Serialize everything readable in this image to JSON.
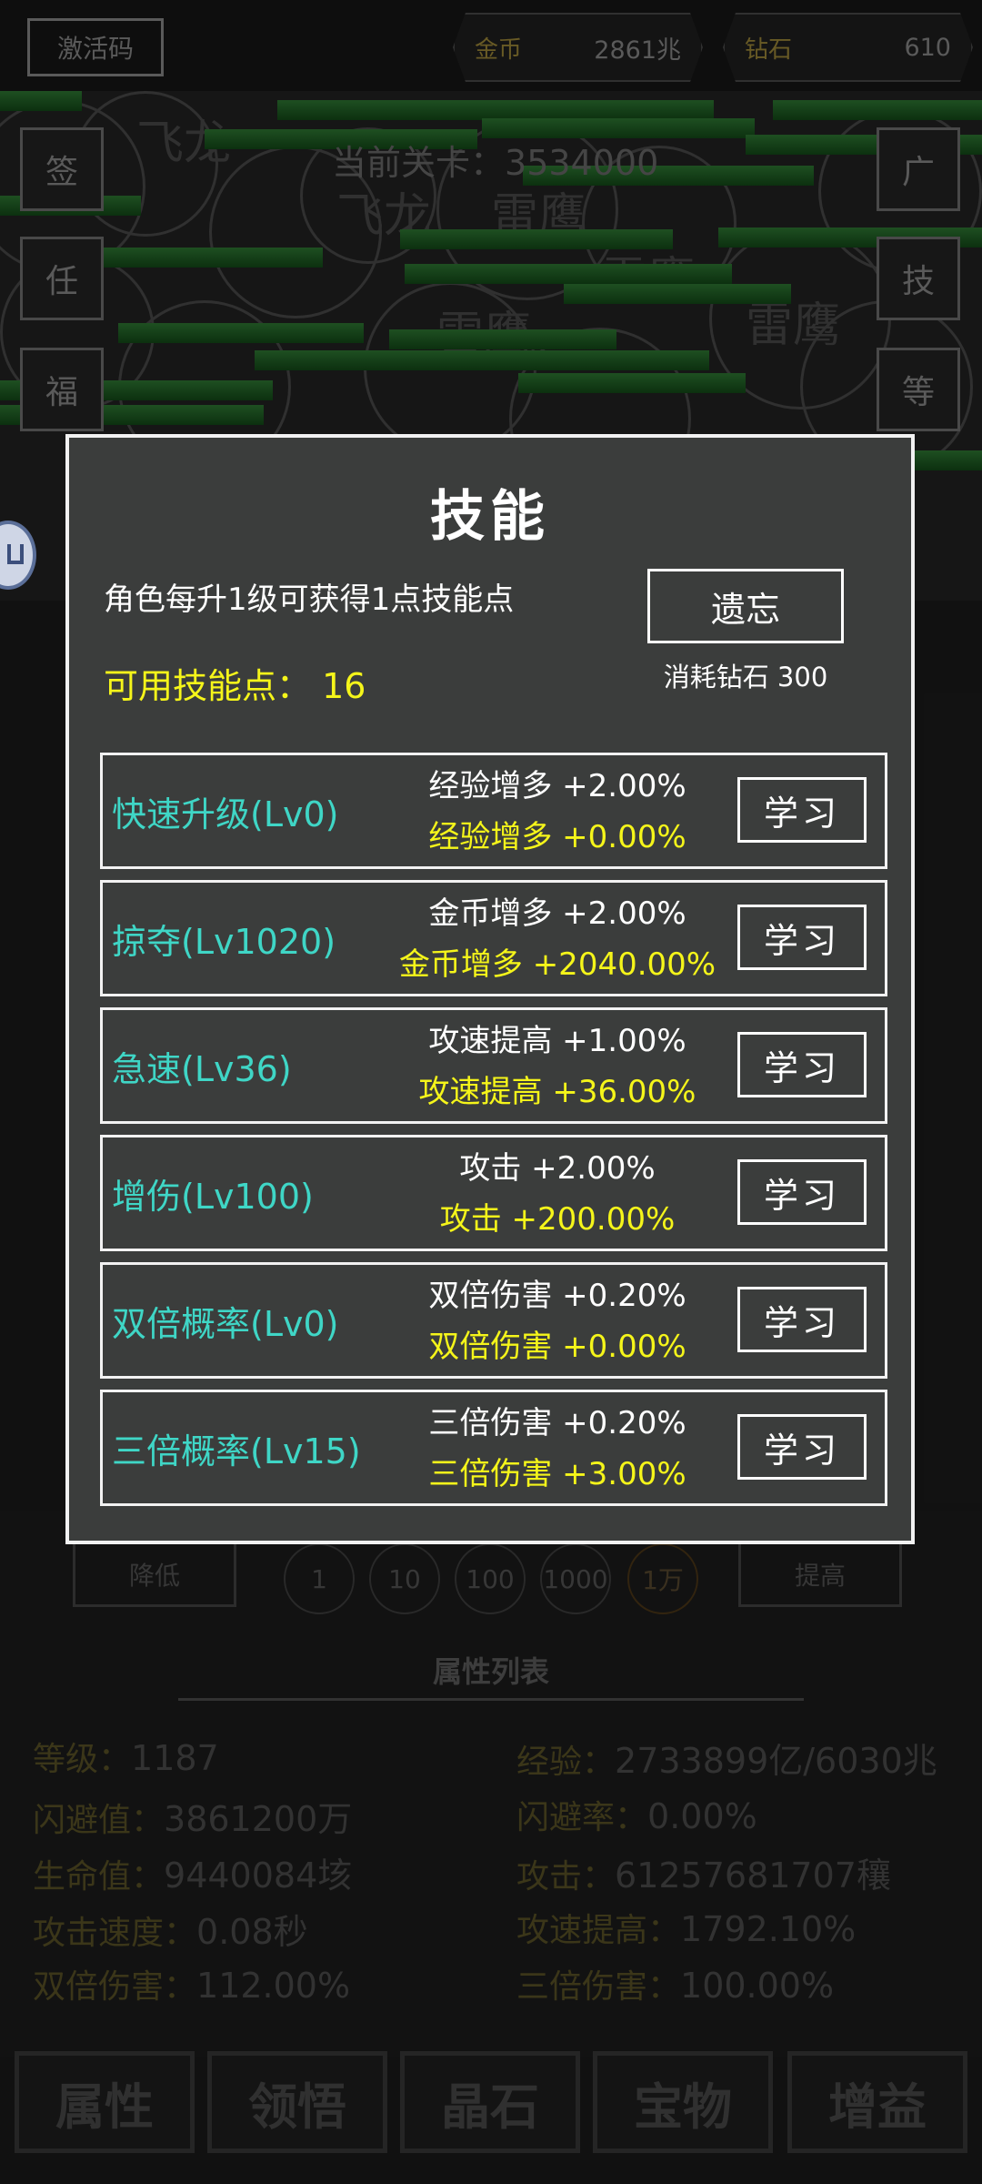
{
  "top_bar": {
    "activation_label": "激活码",
    "gold_label": "金币",
    "gold_value": "2861兆",
    "diamond_label": "钻石",
    "diamond_value": "610"
  },
  "battle": {
    "stage_label": "当前关卡：",
    "stage_value": "3534000",
    "left_buttons": [
      "签",
      "任",
      "福"
    ],
    "right_buttons": [
      "广",
      "技",
      "等"
    ],
    "monster_names": [
      "飞龙",
      "飞龙",
      "雷鹰",
      "雷鹰",
      "雷鹰",
      "雷鹰"
    ]
  },
  "skills_modal": {
    "title": "技能",
    "hint": "角色每升1级可获得1点技能点",
    "available_points_label": "可用技能点：",
    "available_points_value": "16",
    "forget_label": "遗忘",
    "forget_cost": "消耗钻石 300",
    "skills": [
      {
        "name": "快速升级(Lv0)",
        "base_effect": "经验增多 +2.00%",
        "current_effect": "经验增多 +0.00%",
        "learn_label": "学习"
      },
      {
        "name": "掠夺(Lv1020)",
        "base_effect": "金币增多 +2.00%",
        "current_effect": "金币增多 +2040.00%",
        "learn_label": "学习"
      },
      {
        "name": "急速(Lv36)",
        "base_effect": "攻速提高 +1.00%",
        "current_effect": "攻速提高 +36.00%",
        "learn_label": "学习"
      },
      {
        "name": "增伤(Lv100)",
        "base_effect": "攻击 +2.00%",
        "current_effect": "攻击 +200.00%",
        "learn_label": "学习"
      },
      {
        "name": "双倍概率(Lv0)",
        "base_effect": "双倍伤害 +0.20%",
        "current_effect": "双倍伤害 +0.00%",
        "learn_label": "学习"
      },
      {
        "name": "三倍概率(Lv15)",
        "base_effect": "三倍伤害 +0.20%",
        "current_effect": "三倍伤害 +3.00%",
        "learn_label": "学习"
      }
    ]
  },
  "lower": {
    "decrease_label": "降低",
    "increase_label": "提高",
    "multipliers": [
      "1",
      "10",
      "100",
      "1000",
      "1万"
    ],
    "attributes_title": "属性列表",
    "attributes": [
      {
        "key": "等级：",
        "value": "1187"
      },
      {
        "key": "经验：",
        "value": "2733899亿/6030兆"
      },
      {
        "key": "闪避值：",
        "value": "3861200万"
      },
      {
        "key": "闪避率：",
        "value": "0.00%"
      },
      {
        "key": "生命值：",
        "value": "9440084垓"
      },
      {
        "key": "攻击：",
        "value": "61257681707穰"
      },
      {
        "key": "攻击速度：",
        "value": "0.08秒"
      },
      {
        "key": "攻速提高：",
        "value": "1792.10%"
      },
      {
        "key": "双倍伤害：",
        "value": "112.00%"
      },
      {
        "key": "三倍伤害：",
        "value": "100.00%"
      }
    ]
  },
  "bottom_tabs": [
    "属性",
    "领悟",
    "晶石",
    "宝物",
    "增益"
  ],
  "colors": {
    "accent_cyan": "#3fd6c6",
    "accent_yellow": "#f5f51a",
    "modal_bg": "#3b3d3c"
  }
}
